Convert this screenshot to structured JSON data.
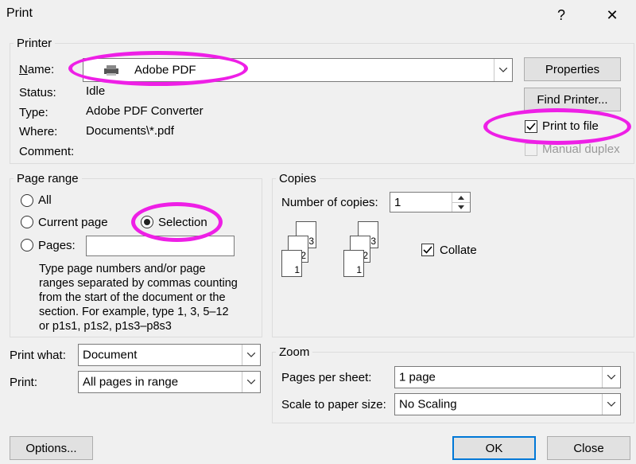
{
  "window": {
    "title": "Print",
    "help_icon": "?",
    "close_icon": "✕"
  },
  "printer": {
    "group_label": "Printer",
    "name_label": "Name:",
    "name_value": "Adobe PDF",
    "status_label": "Status:",
    "status_value": "Idle",
    "type_label": "Type:",
    "type_value": "Adobe PDF Converter",
    "where_label": "Where:",
    "where_value": "Documents\\*.pdf",
    "comment_label": "Comment:",
    "properties_button": "Properties",
    "find_printer_button": "Find Printer...",
    "print_to_file_label": "Print to file",
    "print_to_file_checked": true,
    "manual_duplex_label": "Manual duplex",
    "manual_duplex_checked": false
  },
  "page_range": {
    "group_label": "Page range",
    "all_label": "All",
    "current_page_label": "Current page",
    "selection_label": "Selection",
    "pages_label": "Pages:",
    "pages_value": "",
    "selected": "selection",
    "help_text_lines": [
      "Type page numbers and/or page",
      "ranges separated by commas counting",
      "from the start of the document or the",
      "section. For example, type 1, 3, 5–12",
      "or p1s1, p1s2, p1s3–p8s3"
    ]
  },
  "copies": {
    "group_label": "Copies",
    "number_label": "Number of copies:",
    "number_value": "1",
    "collate_label": "Collate",
    "collate_checked": true,
    "page_numbers": [
      "1",
      "2",
      "3"
    ]
  },
  "print_what": {
    "label": "Print what:",
    "value": "Document"
  },
  "print": {
    "label": "Print:",
    "value": "All pages in range"
  },
  "zoom": {
    "group_label": "Zoom",
    "pages_per_sheet_label": "Pages per sheet:",
    "pages_per_sheet_value": "1 page",
    "scale_label": "Scale to paper size:",
    "scale_value": "No Scaling"
  },
  "footer": {
    "options_button": "Options...",
    "ok_button": "OK",
    "close_button": "Close"
  },
  "annotation": {
    "highlight_color": "#ee1fe6"
  }
}
